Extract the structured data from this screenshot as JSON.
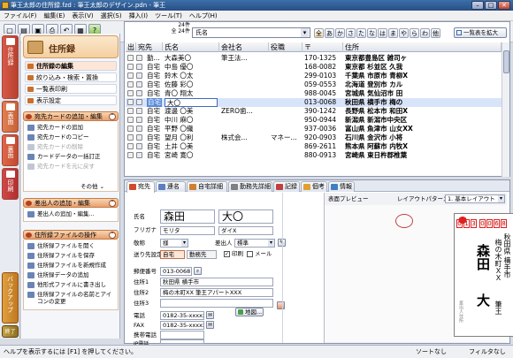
{
  "window": {
    "title": "筆王太郎の住所録.fzd : 筆王太郎のデザイン.pdn - 筆王",
    "min_label": "–",
    "max_label": "□",
    "close_label": "✕"
  },
  "menu": [
    "ファイル(F)",
    "編集(E)",
    "表示(V)",
    "選択(S)",
    "挿入(I)",
    "ツール(T)",
    "ヘルプ(H)"
  ],
  "toolbar": {
    "count_top": "24件",
    "count_bottom": "全 24件",
    "sort_value": "氏名",
    "kana": [
      "全",
      "あ",
      "か",
      "さ",
      "た",
      "な",
      "は",
      "ま",
      "や",
      "ら",
      "わ",
      "他"
    ],
    "list_toggle": "一覧表を拡大"
  },
  "navtabs": [
    "住所録",
    "表面",
    "裏面",
    "印刷"
  ],
  "sidepanel": {
    "header": "住所録",
    "items": [
      "住所録の編集",
      "絞り込み・検索・置換",
      "一覧表印刷",
      "表示設定"
    ],
    "groups": [
      {
        "title": "宛先カードの追加・編集",
        "rows": [
          "宛先カードの追加",
          "宛先カードのコピー",
          "宛先カードの削除",
          "カードデータの一括訂正",
          "宛先カードを元に戻す"
        ],
        "disabled": [
          false,
          false,
          true,
          false,
          true
        ],
        "more": "その他"
      },
      {
        "title": "差出人の追加・編集",
        "rows": [
          "差出人の追加・編集..."
        ],
        "disabled": [
          false
        ]
      },
      {
        "title": "住所録ファイルの操作",
        "rows": [
          "住所録ファイルを開く",
          "住所録ファイルを保存",
          "住所録ファイルを新規作成",
          "住所録データの追加",
          "他形式ファイルに書き出し",
          "住所録ファイルの名前とアイコンの変更"
        ],
        "disabled": [
          false,
          false,
          false,
          false,
          false,
          false
        ]
      }
    ],
    "backup": "バックアップ",
    "close": "終了"
  },
  "table": {
    "headers": [
      "出",
      "宛先",
      "氏名",
      "会社名",
      "役職",
      "〒",
      "住所"
    ],
    "rows": [
      [
        "",
        "勤...",
        "大森美〇",
        "筆王法...",
        "",
        "170-1325",
        "東京都豊島区 雑司ヶ"
      ],
      [
        "",
        "自宅",
        "中島 優〇",
        "",
        "",
        "168-0082",
        "東京都 杉並区 久我"
      ],
      [
        "",
        "自宅",
        "鈴木 〇太",
        "",
        "",
        "299-0103",
        "千葉県 市原市 青柳X"
      ],
      [
        "",
        "自宅",
        "佐藤 彩〇",
        "",
        "",
        "059-0553",
        "北海道 登別市 カル"
      ],
      [
        "",
        "自宅",
        "青〇 翔太",
        "",
        "",
        "988-0045",
        "宮城県 気仙沼市 田"
      ],
      [
        "",
        "自宅",
        "森田 大〇",
        "",
        "",
        "013-0068",
        "秋田県 横手市 梅の"
      ],
      [
        "",
        "自宅",
        "渡邊 〇美",
        "ZERO歯...",
        "",
        "390-1242",
        "長野県 松本市 和田X"
      ],
      [
        "",
        "自宅",
        "中川 麻〇",
        "",
        "",
        "950-0944",
        "新潟県 新潟市中央区"
      ],
      [
        "",
        "自宅",
        "平野 〇織",
        "",
        "",
        "937-0036",
        "富山県 魚津市 山女XX"
      ],
      [
        "",
        "自宅",
        "望月 〇利",
        "株式会...",
        "マネー...",
        "920-0903",
        "石川県 金沢市 小将"
      ],
      [
        "",
        "自宅",
        "土井 〇美",
        "",
        "",
        "869-2611",
        "熊本県 阿蘇市 内牧X"
      ],
      [
        "",
        "自宅",
        "宮崎 寛〇",
        "",
        "",
        "880-0913",
        "宮崎県 東日杵郡椎葉"
      ]
    ],
    "selected_index": 5,
    "selected_editing": "大〇"
  },
  "detail": {
    "tabs": [
      "宛先",
      "連名",
      "自宅詳細",
      "勤務先詳細",
      "記録",
      "個考",
      "情報"
    ],
    "fields": {
      "name_label": "氏名",
      "last_name": "森田",
      "first_name": "大〇",
      "furigana_label": "フリガナ",
      "furigana_last": "モリタ",
      "furigana_first": "ダイX",
      "title_label": "敬称",
      "title_value": "様",
      "sender_label": "差出人",
      "sender_value": "標準",
      "address_dest_label": "送り先設定",
      "dest_home": "自宅",
      "dest_work": "勤務先",
      "print_label": "印刷",
      "mail_label": "メール",
      "zip_label": "郵便番号",
      "zip_value": "013-0068",
      "address1_label": "住所1",
      "address1_value": "秋田県 横手市",
      "address2_label": "住所2",
      "address2_value": "梅の木町XX 筆王アパートXXX",
      "address3_label": "住所3",
      "map_button": "地図...",
      "phone_label": "電話",
      "phone_value": "0182-35-xxxxx",
      "fax_label": "FAX",
      "fax_value": "0182-35-xxxxx",
      "mobile_label": "携帯電話",
      "ip_label": "IP電話"
    }
  },
  "preview": {
    "label": "表面プレビュー",
    "layout_label": "レイアウトパターン",
    "layout_value": "1. 基本レイアウト",
    "zip_digits": [
      "0",
      "1",
      "3",
      "0",
      "0",
      "6",
      "8"
    ],
    "card_address1": "秋田県 横手市",
    "card_address2": "梅の木町ＸＸ",
    "card_address3": "筆王",
    "card_name_last": "森田",
    "card_name_first": "大",
    "sender_small": "差出人住所"
  },
  "status": {
    "help": "ヘルプを表示するには [F1] を押してください。",
    "sort": "ソートなし",
    "filter": "フィルタなし"
  }
}
